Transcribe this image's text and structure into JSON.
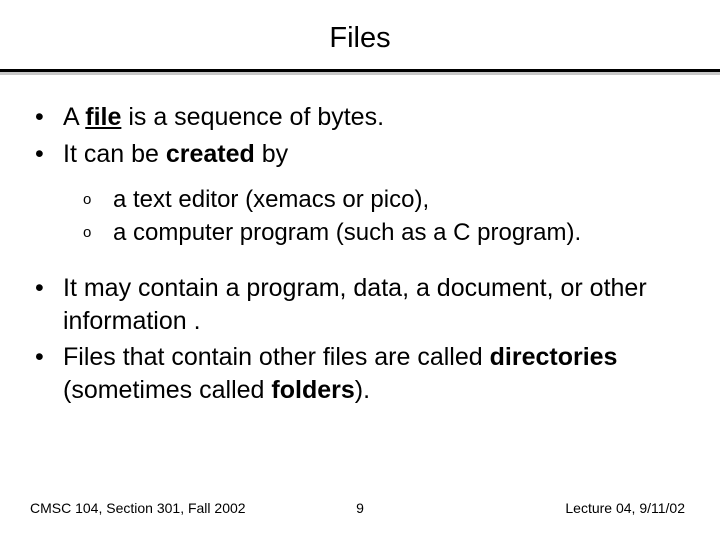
{
  "title": "Files",
  "bullets": {
    "b1_pre": "A ",
    "b1_key": "file",
    "b1_post": " is a sequence of bytes.",
    "b2_pre": "It can be ",
    "b2_key": "created",
    "b2_post": " by",
    "s1": "a text editor (xemacs or pico),",
    "s2": "a computer program (such as a C program).",
    "b3": "It may contain a program, data, a document, or other information .",
    "b4_pre": "Files that contain other files are called ",
    "b4_key1": "directories",
    "b4_mid": " (sometimes called ",
    "b4_key2": "folders",
    "b4_post": ")."
  },
  "footer": {
    "left": "CMSC 104, Section 301, Fall 2002",
    "center": "9",
    "right": "Lecture 04, 9/11/02"
  },
  "sym": {
    "bullet": "•",
    "sub": "o"
  }
}
